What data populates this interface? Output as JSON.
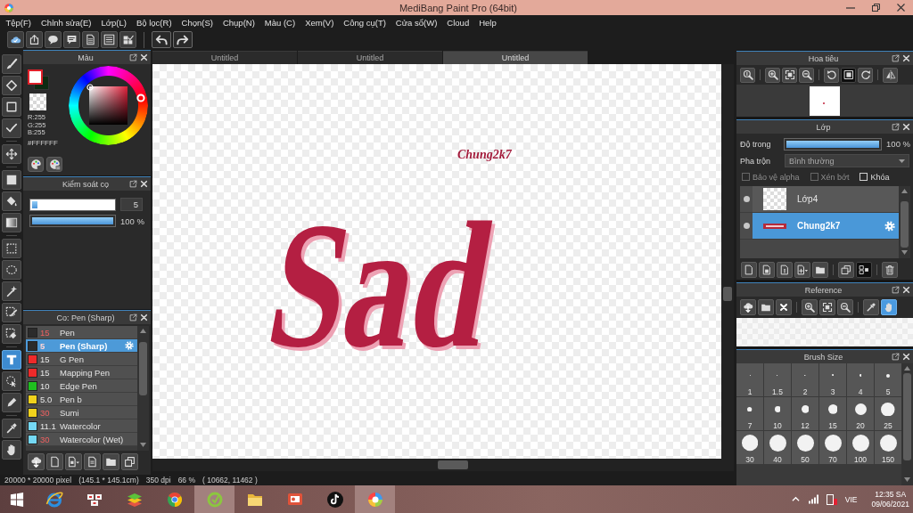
{
  "window": {
    "title": "MediBang Paint Pro (64bit)"
  },
  "menu": [
    "Tệp(F)",
    "Chỉnh sửa(E)",
    "Lớp(L)",
    "Bộ lọc(R)",
    "Chọn(S)",
    "Chụp(N)",
    "Màu (C)",
    "Xem(V)",
    "Công cụ(T)",
    "Cửa sổ(W)",
    "Cloud",
    "Help"
  ],
  "tool_groups": [
    [
      {
        "kind": "brush",
        "selected": false
      },
      {
        "kind": "eraser",
        "selected": false
      },
      {
        "kind": "outline",
        "selected": false
      },
      {
        "kind": "polyline",
        "selected": false
      }
    ],
    [
      {
        "kind": "move",
        "selected": false
      }
    ],
    [
      {
        "kind": "fill",
        "selected": false
      },
      {
        "kind": "bucket",
        "selected": false
      },
      {
        "kind": "gradient",
        "selected": false
      }
    ],
    [
      {
        "kind": "marquee",
        "selected": false
      },
      {
        "kind": "lasso",
        "selected": false
      },
      {
        "kind": "wand",
        "selected": false
      },
      {
        "kind": "selpen",
        "selected": false
      },
      {
        "kind": "selerase",
        "selected": false
      }
    ],
    [
      {
        "kind": "text",
        "selected": true
      },
      {
        "kind": "operation",
        "selected": false
      },
      {
        "kind": "pen",
        "selected": false
      }
    ],
    [
      {
        "kind": "dropper",
        "selected": false
      },
      {
        "kind": "hand",
        "selected": false
      }
    ]
  ],
  "color_panel": {
    "title": "Màu",
    "foreground": {
      "color": "#ffffff"
    },
    "background": {
      "color": "#0e2a12"
    },
    "channels": [
      "R:255",
      "G:255",
      "B:255"
    ],
    "hex": "#FFFFFF"
  },
  "brush_control": {
    "title": "Kiểm soát cọ",
    "size": {
      "level": 0.07,
      "value": "5"
    },
    "opacity": {
      "level": 1,
      "reading": "100 %"
    }
  },
  "brush_panel": {
    "title": "Co: Pen (Sharp)",
    "brushes": [
      {
        "color": "#2b2b2b",
        "size": "15",
        "size_accent": true,
        "name": "Pen",
        "selected": false
      },
      {
        "color": "#2b2b2b",
        "size": "5",
        "size_accent": true,
        "name": "Pen (Sharp)",
        "selected": true
      },
      {
        "color": "#ee2a2a",
        "size": "15",
        "size_accent": false,
        "name": "G Pen",
        "selected": false
      },
      {
        "color": "#ee2a2a",
        "size": "15",
        "size_accent": false,
        "name": "Mapping Pen",
        "selected": false
      },
      {
        "color": "#1fbf1f",
        "size": "10",
        "size_accent": false,
        "name": "Edge Pen",
        "selected": false
      },
      {
        "color": "#f0d21c",
        "size": "5.0",
        "size_accent": false,
        "name": "Pen b",
        "selected": false
      },
      {
        "color": "#f0d21c",
        "size": "30",
        "size_accent": true,
        "name": "Sumi",
        "selected": false
      },
      {
        "color": "#74d8f4",
        "size": "11.1",
        "size_accent": false,
        "name": "Watercolor",
        "selected": false
      },
      {
        "color": "#74d8f4",
        "size": "30",
        "size_accent": true,
        "name": "Watercolor (Wet)",
        "selected": false
      }
    ]
  },
  "documents": {
    "tabs": [
      {
        "label": "Untitled",
        "selected": false
      },
      {
        "label": "Untitled",
        "selected": false
      },
      {
        "label": "Untitled",
        "selected": true
      }
    ],
    "canvas": {
      "signature": "Chung2k7",
      "lettering": "Sad"
    }
  },
  "status_bar": [
    "20000 * 20000 pixel",
    "(145.1 * 145.1cm)",
    "350 dpi",
    "66 %",
    "( 10662, 11462 )"
  ],
  "navigator": {
    "title": "Hoa tiêu",
    "tool_groups": [
      [
        {
          "kind": "zoomreset",
          "selected": false
        }
      ],
      [
        {
          "kind": "zoomin",
          "selected": false
        },
        {
          "kind": "fit",
          "selected": false
        },
        {
          "kind": "zoomout",
          "selected": false
        }
      ],
      [
        {
          "kind": "rotleft",
          "selected": false
        },
        {
          "kind": "frame",
          "selected": true
        },
        {
          "kind": "rotright",
          "selected": false
        }
      ],
      [
        {
          "kind": "flip",
          "selected": false
        }
      ]
    ]
  },
  "layers": {
    "title": "Lớp",
    "opacity_label": "Độ trong",
    "opacity": {
      "level": 1,
      "reading": "100 %"
    },
    "blend_label": "Pha trộn",
    "blend_mode": "Bình thường",
    "options": [
      {
        "label": "Bảo vệ alpha",
        "checked": false,
        "disabled": true
      },
      {
        "label": "Xén bớt",
        "checked": false,
        "disabled": true
      },
      {
        "label": "Khóa",
        "checked": false,
        "disabled": false
      }
    ],
    "items": [
      {
        "name": "Lớp4",
        "kind": "blank",
        "visible": true,
        "selected": false
      },
      {
        "name": "Chung2k7",
        "kind": "lettering",
        "visible": true,
        "selected": true
      }
    ],
    "tool_groups": [
      [
        {
          "kind": "newpage",
          "selected": false
        },
        {
          "kind": "imgpage",
          "selected": false
        },
        {
          "kind": "linepage",
          "selected": false
        },
        {
          "kind": "addpage",
          "selected": false
        },
        {
          "kind": "folder",
          "selected": false
        }
      ],
      [
        {
          "kind": "copy",
          "selected": false
        },
        {
          "kind": "merge",
          "selected": true
        }
      ],
      [
        {
          "kind": "trash",
          "selected": false
        }
      ]
    ]
  },
  "reference": {
    "title": "Reference",
    "tool_groups": [
      [
        {
          "kind": "clouddl",
          "selected": false
        },
        {
          "kind": "folder",
          "selected": false
        },
        {
          "kind": "closex",
          "selected": false
        }
      ],
      [
        {
          "kind": "zoomin",
          "selected": false
        },
        {
          "kind": "fit",
          "selected": false
        },
        {
          "kind": "zoomout",
          "selected": false
        }
      ],
      [
        {
          "kind": "dropper",
          "selected": false
        },
        {
          "kind": "hand",
          "selected": true
        }
      ]
    ]
  },
  "brush_sizes": {
    "title": "Brush Size",
    "sizes": [
      "1",
      "1.5",
      "2",
      "3",
      "4",
      "5",
      "7",
      "10",
      "12",
      "15",
      "20",
      "25",
      "30",
      "40",
      "50",
      "70",
      "100",
      "150"
    ]
  },
  "taskbar": {
    "apps": [
      {
        "kind": "browser",
        "highlighted": false
      },
      {
        "kind": "tiles",
        "highlighted": false
      },
      {
        "kind": "stack",
        "highlighted": false
      },
      {
        "kind": "chrome",
        "highlighted": false
      },
      {
        "kind": "ring",
        "highlighted": true
      },
      {
        "kind": "explorer",
        "highlighted": false
      },
      {
        "kind": "slides",
        "highlighted": false
      },
      {
        "kind": "note",
        "highlighted": false
      },
      {
        "kind": "paint",
        "highlighted": true
      }
    ],
    "language": "VIE",
    "time": "12:35 SA",
    "date": "09/06/2021"
  }
}
